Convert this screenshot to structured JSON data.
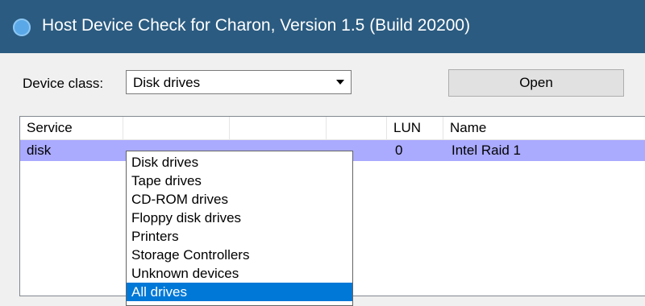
{
  "window": {
    "title": "Host Device Check for Charon, Version 1.5 (Build 20200)",
    "icon": "app-icon"
  },
  "device_class": {
    "label": "Device class:",
    "selected": "Disk drives",
    "options": [
      "Disk drives",
      "Tape drives",
      "CD-ROM drives",
      "Floppy disk drives",
      "Printers",
      "Storage Controllers",
      "Unknown devices",
      "All drives"
    ],
    "highlighted_option": "All drives"
  },
  "open_button": {
    "label": "Open"
  },
  "list": {
    "columns": [
      "Service",
      "",
      "",
      "",
      "LUN",
      "Name"
    ],
    "rows": [
      {
        "service": "disk",
        "lun": "0",
        "name": "Intel Raid 1"
      }
    ],
    "selected_row_color": "#aaaaff"
  },
  "colors": {
    "titlebar": "#2b5b80",
    "highlight": "#0078d7"
  }
}
